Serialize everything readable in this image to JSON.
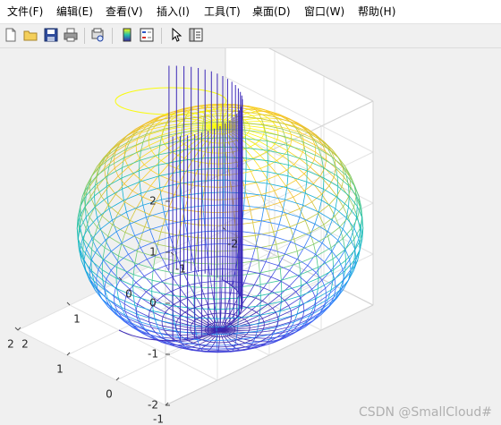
{
  "menu": [
    {
      "label": "文件(F)"
    },
    {
      "label": "编辑(E)"
    },
    {
      "label": "查看(V)"
    },
    {
      "label": "插入(I)"
    },
    {
      "label": "工具(T)"
    },
    {
      "label": "桌面(D)"
    },
    {
      "label": "窗口(W)"
    },
    {
      "label": "帮助(H)"
    }
  ],
  "toolbar": {
    "icons": [
      "new-file-icon",
      "open-folder-icon",
      "save-icon",
      "print-icon",
      "print-preview-icon",
      "colorbar-icon",
      "legend-icon",
      "pointer-icon",
      "property-editor-icon"
    ]
  },
  "axes": {
    "z_ticks": [
      "2",
      "1",
      "0",
      "-1",
      "-2"
    ],
    "x_ticks": [
      "-1",
      "0",
      "1",
      "2"
    ],
    "y_ticks": [
      "-2",
      "-1",
      "0",
      "1",
      "2"
    ]
  },
  "chart_data": {
    "type": "surface",
    "title": "",
    "xlabel": "",
    "ylabel": "",
    "zlabel": "",
    "objects": [
      {
        "shape": "sphere",
        "center": [
          0,
          0,
          0
        ],
        "radius": 2,
        "style": "mesh",
        "colormap": "parula"
      },
      {
        "shape": "cylinder",
        "center_xy": [
          1,
          0
        ],
        "radius": 1,
        "zlim": [
          -2,
          2
        ],
        "style": "vertical lines",
        "color": "#3b28b8"
      }
    ],
    "xlim": [
      -1,
      2
    ],
    "ylim": [
      -2,
      2
    ],
    "zlim": [
      -2,
      2
    ],
    "grid": true
  },
  "watermark": "CSDN @SmallCloud#"
}
